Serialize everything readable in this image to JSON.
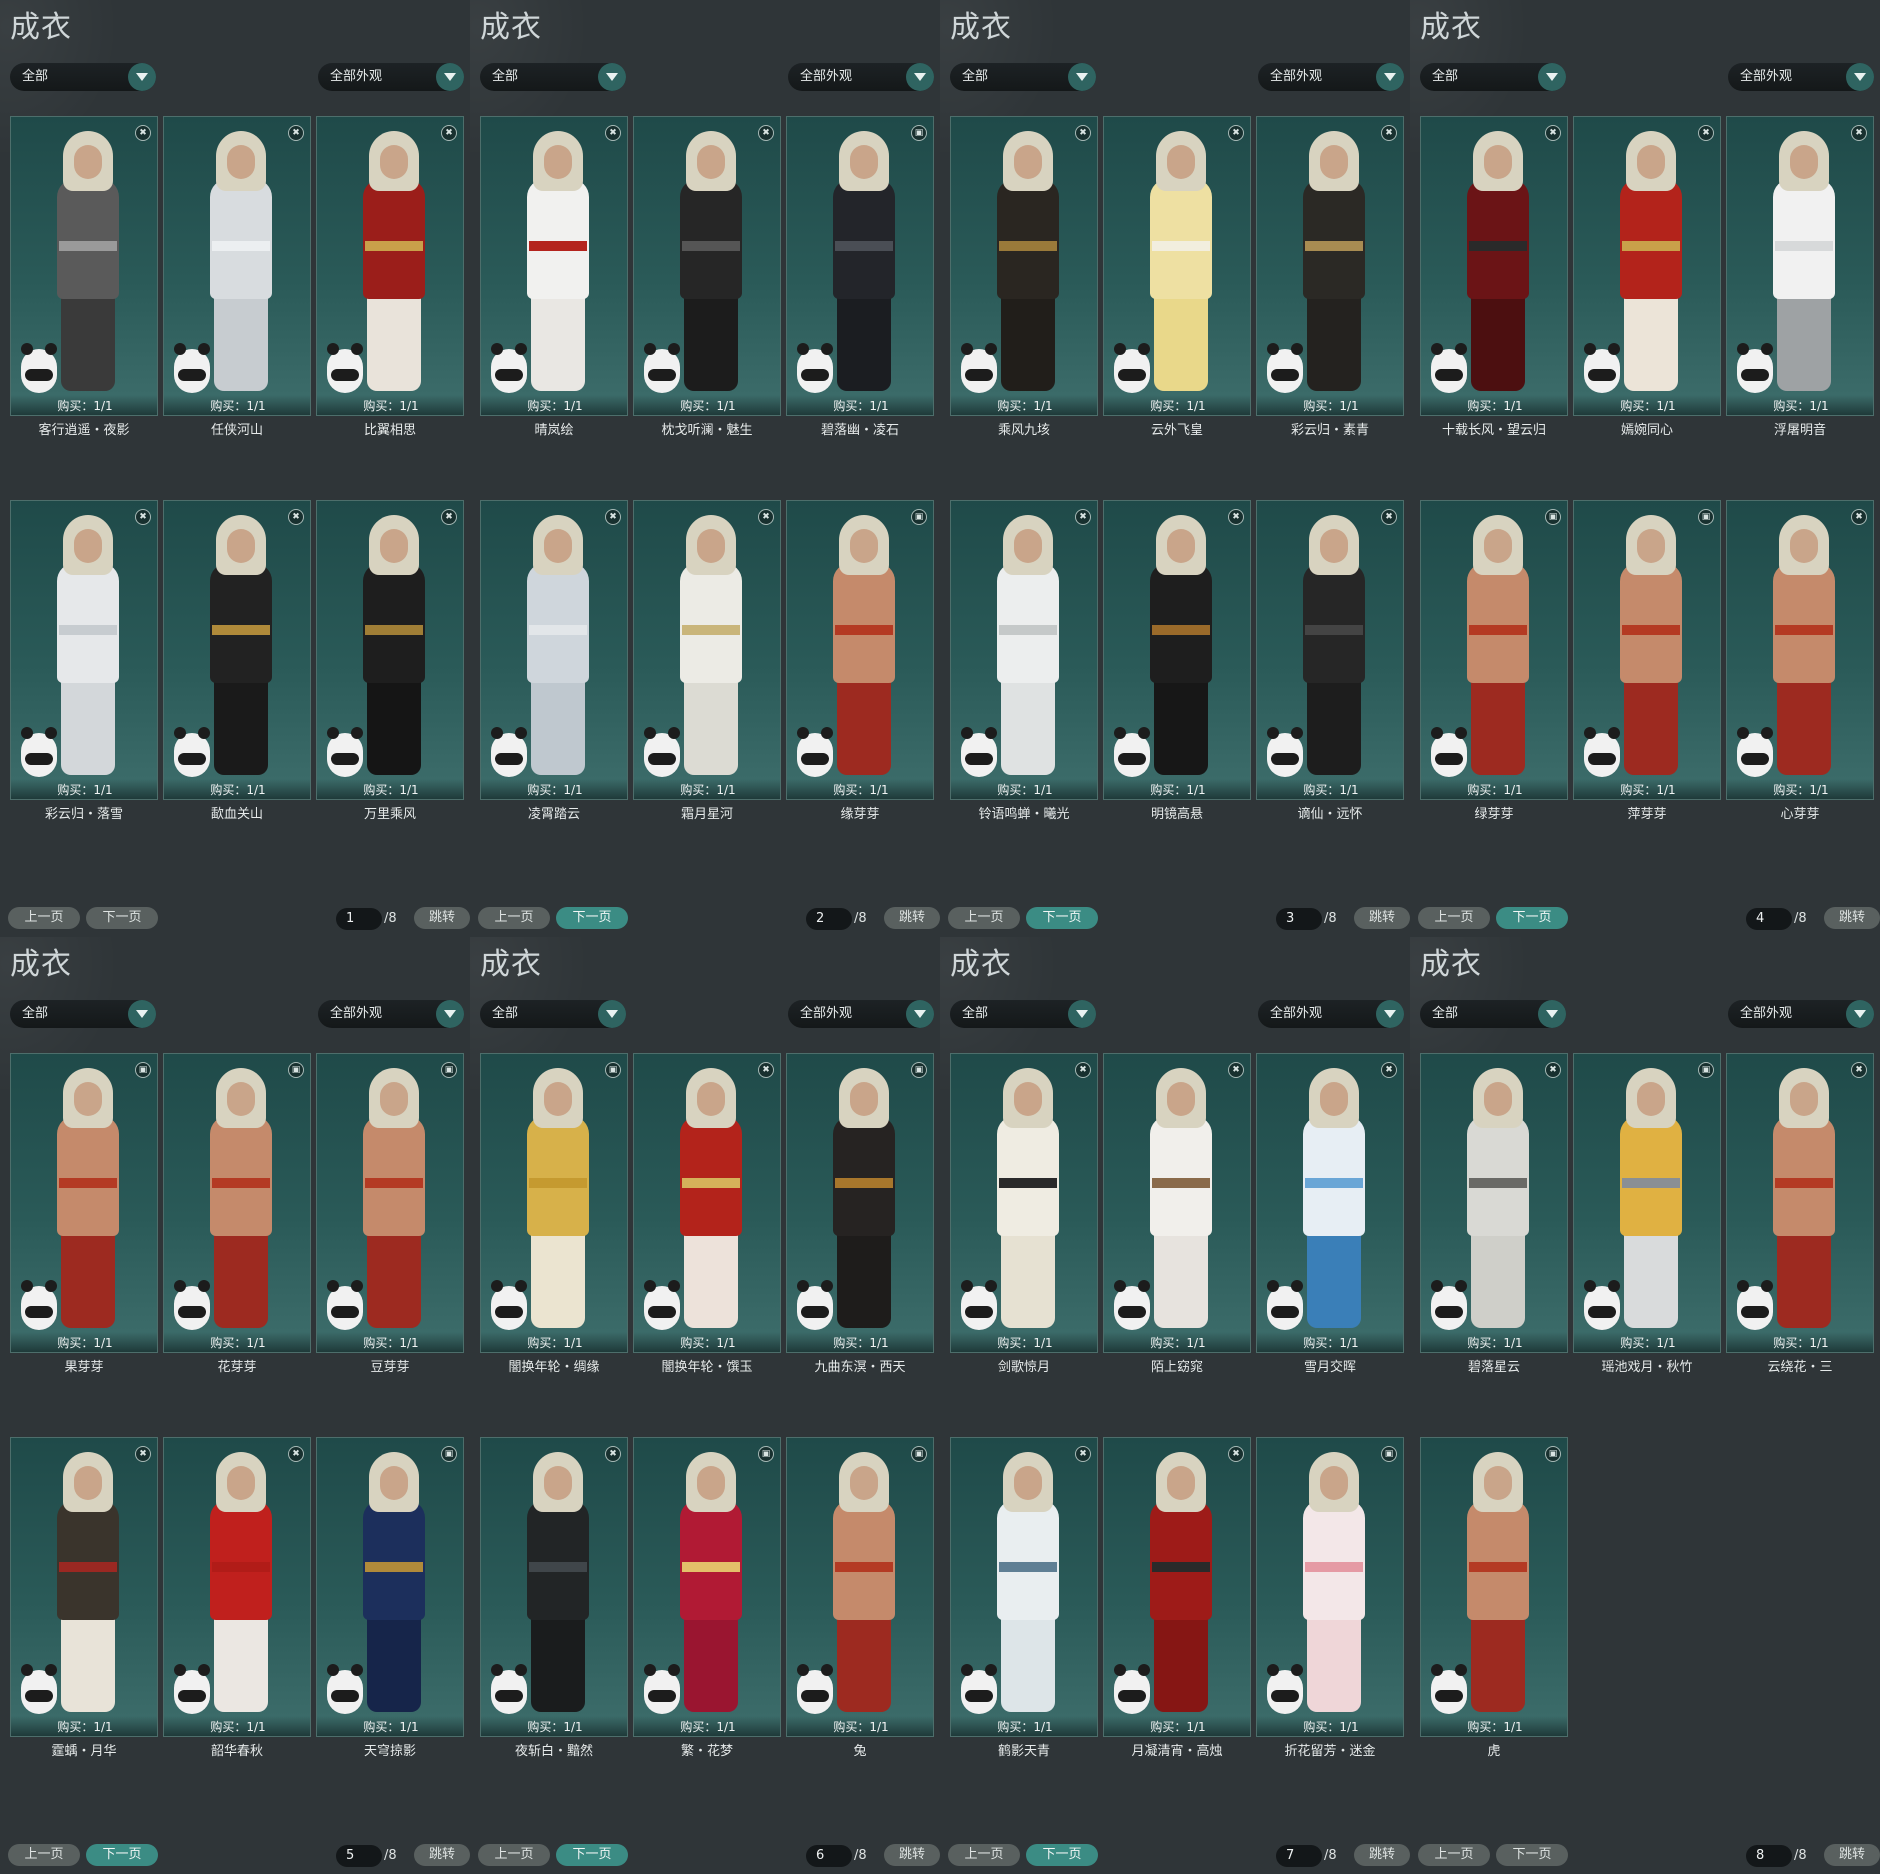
{
  "colors": {
    "background": "#2d3336",
    "card_bg": "#265553",
    "accent_teal": "#3b8c84",
    "button_gray": "#59605f"
  },
  "labels": {
    "title": "成衣",
    "filter_left": "全部",
    "filter_right": "全部外观",
    "prev": "上一页",
    "next": "下一页",
    "jump": "跳转",
    "total": "/8",
    "buy": "购买：1/1"
  },
  "panels": [
    {
      "page": "1",
      "items": [
        {
          "name": "客行逍遥・夜影",
          "icon": "trash-icon",
          "body": "#5a5a5a",
          "legs": "#3a3a3a",
          "sash": "#9a9a9a"
        },
        {
          "name": "任侠河山",
          "icon": "trash-icon",
          "body": "#d8dcdf",
          "legs": "#c7ccd0",
          "sash": "#eceff1"
        },
        {
          "name": "比翼相思",
          "icon": "trash-icon",
          "body": "#9b1e1a",
          "legs": "#e9e3da",
          "sash": "#c9a04a"
        },
        {
          "name": "彩云归・落雪",
          "icon": "trash-icon",
          "body": "#e6e8ea",
          "legs": "#d3d7da",
          "sash": "#c7ccd0"
        },
        {
          "name": "歃血关山",
          "icon": "trash-icon",
          "body": "#222222",
          "legs": "#1a1a1a",
          "sash": "#b08a3a"
        },
        {
          "name": "万里乘风",
          "icon": "trash-icon",
          "body": "#1e1e1e",
          "legs": "#151515",
          "sash": "#a07e36"
        },
        {
          "name": "晴岚绘",
          "icon": "trash-icon",
          "body": "#f1f1ef",
          "legs": "#e9e7e3",
          "sash": "#b4241d"
        },
        {
          "name": "枕戈听澜・魅生",
          "icon": "trash-icon",
          "body": "#262626",
          "legs": "#1c1c1c",
          "sash": "#555555"
        },
        {
          "name": "碧落幽・凌石",
          "icon": "tag-icon",
          "body": "#23252a",
          "legs": "#1b1d21",
          "sash": "#4a4e55"
        },
        {
          "name": "凌霄踏云",
          "icon": "trash-icon",
          "body": "#cfd6dc",
          "legs": "#bfc8cf",
          "sash": "#e2e6e9"
        },
        {
          "name": "霜月星河",
          "icon": "trash-icon",
          "body": "#ecebe5",
          "legs": "#dcdbd3",
          "sash": "#c9b57a"
        },
        {
          "name": "缘芽芽",
          "icon": "tag-icon",
          "body": "#c58a6b",
          "legs": "#9d2a20",
          "sash": "#b43a23"
        }
      ]
    },
    {
      "page": "2",
      "items": [
        {
          "name": "乘风九垓",
          "icon": "trash-icon",
          "body": "#2a2621",
          "legs": "#211e1a",
          "sash": "#9a7a3a"
        },
        {
          "name": "云外飞皇",
          "icon": "trash-icon",
          "body": "#eee0a2",
          "legs": "#e9d88a",
          "sash": "#f2eede"
        },
        {
          "name": "彩云归・素青",
          "icon": "trash-icon",
          "body": "#2b2925",
          "legs": "#24221f",
          "sash": "#a88c52"
        },
        {
          "name": "铃语鸣蝉・曦光",
          "icon": "trash-icon",
          "body": "#eceeee",
          "legs": "#dfe2e2",
          "sash": "#c5c9c9"
        },
        {
          "name": "明镜高悬",
          "icon": "trash-icon",
          "body": "#1e1e1e",
          "legs": "#171717",
          "sash": "#9a6a2a"
        },
        {
          "name": "谪仙・远怀",
          "icon": "trash-icon",
          "body": "#262626",
          "legs": "#1d1d1d",
          "sash": "#444444"
        },
        {
          "name": "十载长风・望云归",
          "icon": "trash-icon",
          "body": "#6b1416",
          "legs": "#4c0f10",
          "sash": "#2a2a2a"
        },
        {
          "name": "嫣婉同心",
          "icon": "trash-icon",
          "body": "#b3231b",
          "legs": "#ece4d8",
          "sash": "#c9a04a"
        },
        {
          "name": "浮屠明音",
          "icon": "trash-icon",
          "body": "#f1f1f1",
          "legs": "#9ea2a4",
          "sash": "#d7d9da"
        },
        {
          "name": "绿芽芽",
          "icon": "tag-icon",
          "body": "#c58a6b",
          "legs": "#9d2a20",
          "sash": "#b43a23"
        },
        {
          "name": "萍芽芽",
          "icon": "tag-icon",
          "body": "#c58a6b",
          "legs": "#9d2a20",
          "sash": "#b43a23"
        },
        {
          "name": "心芽芽",
          "icon": "trash-icon",
          "body": "#c58a6b",
          "legs": "#9d2a20",
          "sash": "#b43a23"
        }
      ]
    },
    {
      "page": "3",
      "items": [
        {
          "name": "果芽芽",
          "icon": "tag-icon",
          "body": "#c58a6b",
          "legs": "#9d2a20",
          "sash": "#b43a23"
        },
        {
          "name": "花芽芽",
          "icon": "tag-icon",
          "body": "#c58a6b",
          "legs": "#9d2a20",
          "sash": "#b43a23"
        },
        {
          "name": "豆芽芽",
          "icon": "tag-icon",
          "body": "#c58a6b",
          "legs": "#9d2a20",
          "sash": "#b43a23"
        },
        {
          "name": "霆蝺・月华",
          "icon": "trash-icon",
          "body": "#3a342c",
          "legs": "#e8e3d8",
          "sash": "#9b2822"
        },
        {
          "name": "韶华春秋",
          "icon": "trash-icon",
          "body": "#c0201d",
          "legs": "#ebe7e2",
          "sash": "#b11c18"
        },
        {
          "name": "天穹掠影",
          "icon": "tag-icon",
          "body": "#1c2f5c",
          "legs": "#16254a",
          "sash": "#b08a3a"
        },
        {
          "name": "闇换年轮・绸缘",
          "icon": "tag-icon",
          "body": "#d7b14a",
          "legs": "#ebe4d0",
          "sash": "#c59a30"
        },
        {
          "name": "闇换年轮・馔玉",
          "icon": "trash-icon",
          "body": "#b3231b",
          "legs": "#ede2da",
          "sash": "#d5b15a"
        },
        {
          "name": "九曲东溟・西天",
          "icon": "tag-icon",
          "body": "#262322",
          "legs": "#1e1c1b",
          "sash": "#a8772c"
        },
        {
          "name": "夜斩白・黯然",
          "icon": "trash-icon",
          "body": "#222526",
          "legs": "#1a1c1d",
          "sash": "#40464a"
        },
        {
          "name": "繁・花梦",
          "icon": "tag-icon",
          "body": "#b11a34",
          "legs": "#9a1530",
          "sash": "#e3c06a"
        },
        {
          "name": "兔",
          "icon": "tag-icon",
          "body": "#c58a6b",
          "legs": "#9d2a20",
          "sash": "#b43a23"
        }
      ]
    },
    {
      "page": "4",
      "items": [
        {
          "name": "剑歌惊月",
          "icon": "trash-icon",
          "body": "#efece2",
          "legs": "#e6e1d2",
          "sash": "#2a2a2a"
        },
        {
          "name": "陌上窈窕",
          "icon": "trash-icon",
          "body": "#f1efeb",
          "legs": "#e7e3de",
          "sash": "#8a6a4a"
        },
        {
          "name": "雪月交晖",
          "icon": "trash-icon",
          "body": "#e7eef4",
          "legs": "#3a7fb8",
          "sash": "#6aa6d6"
        },
        {
          "name": "鹤影天青",
          "icon": "trash-icon",
          "body": "#e9eef0",
          "legs": "#dde5e8",
          "sash": "#5f7f94"
        },
        {
          "name": "月凝清宵・高烛",
          "icon": "trash-icon",
          "body": "#9e1b18",
          "legs": "#861614",
          "sash": "#2a2a2a"
        },
        {
          "name": "折花留芳・迷金",
          "icon": "tag-icon",
          "body": "#f3e7e8",
          "legs": "#efd6d8",
          "sash": "#e59aa4"
        },
        {
          "name": "碧落星云",
          "icon": "trash-icon",
          "body": "#d9d9d4",
          "legs": "#cfcfc9",
          "sash": "#6a6a66"
        },
        {
          "name": "瑶池戏月・秋竹",
          "icon": "tag-icon",
          "body": "#e0b142",
          "legs": "#d9dbdc",
          "sash": "#8a8f94"
        },
        {
          "name": "云绕花・三",
          "icon": "trash-icon",
          "body": "#c58a6b",
          "legs": "#9d2a20",
          "sash": "#b43a23"
        },
        {
          "name": "虎",
          "icon": "tag-icon",
          "body": "#c58a6b",
          "legs": "#9d2a20",
          "sash": "#b43a23"
        }
      ]
    }
  ]
}
